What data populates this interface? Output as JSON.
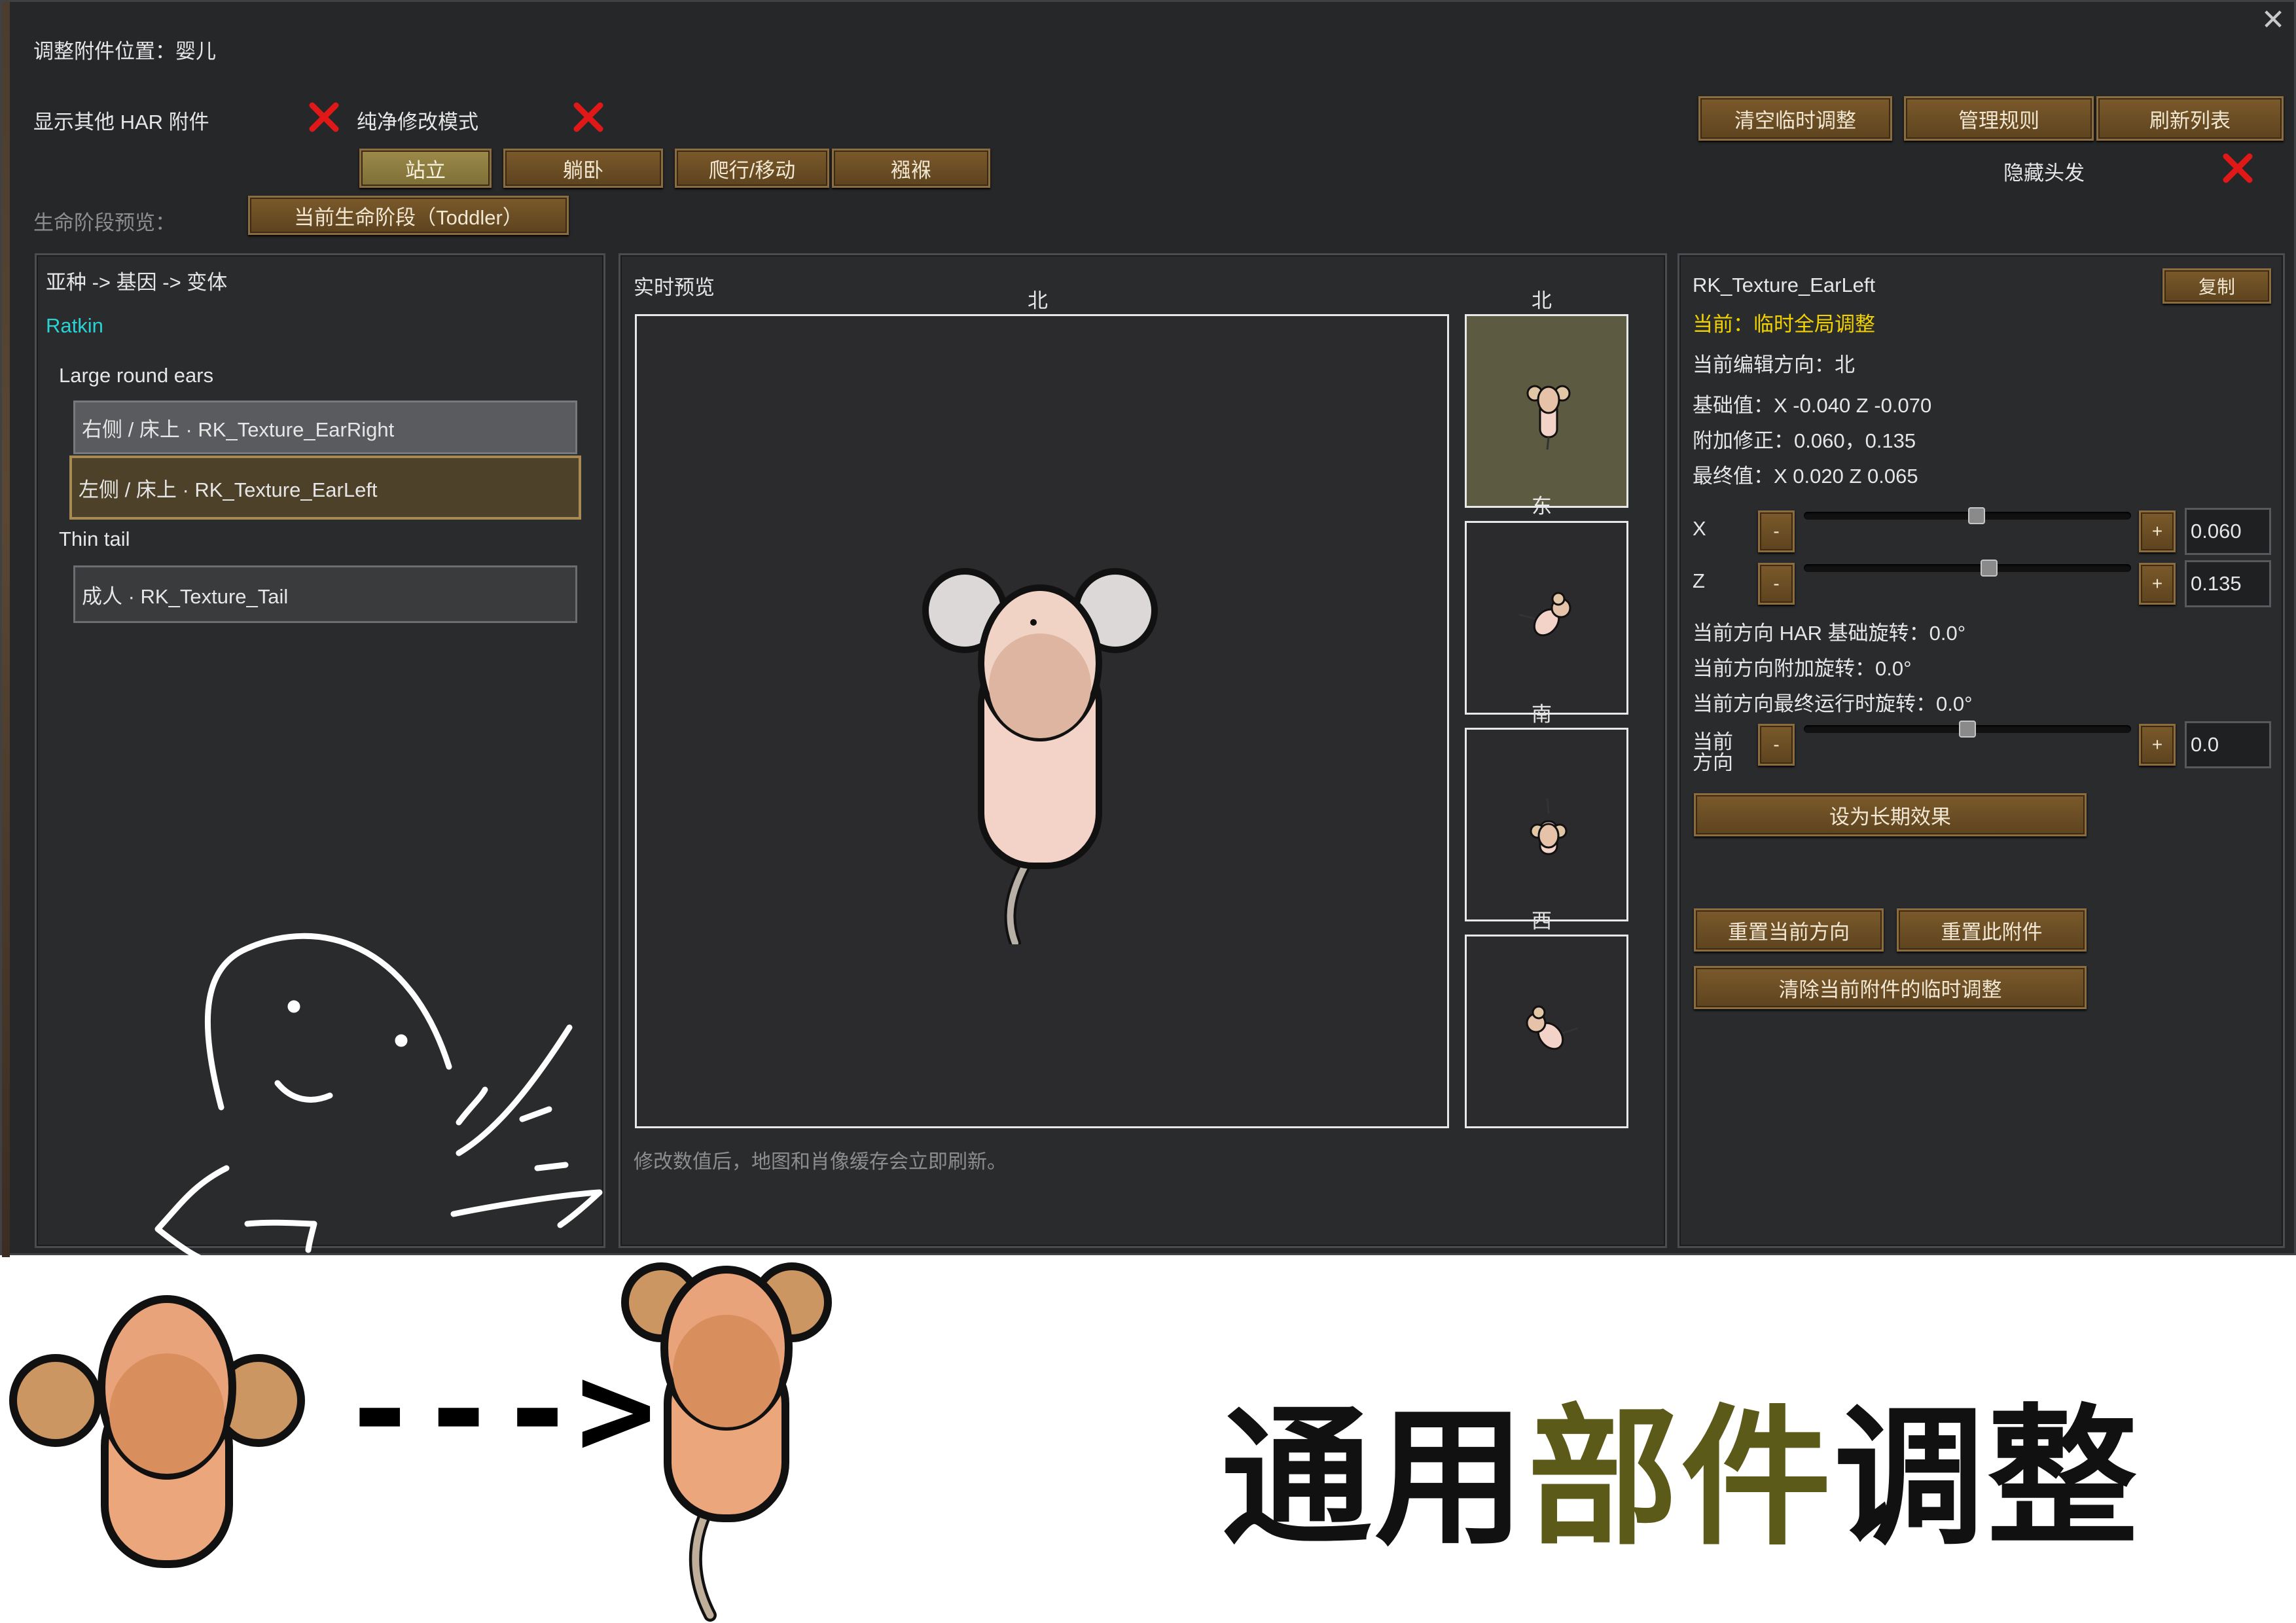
{
  "window": {
    "title": "调整附件位置：婴儿"
  },
  "toolbar": {
    "show_other_har": "显示其他 HAR 附件",
    "pure_edit_mode": "纯净修改模式",
    "clear_temp": "清空临时调整",
    "manage_rules": "管理规则",
    "refresh_list": "刷新列表",
    "hide_hair": "隐藏头发",
    "poses": [
      "站立",
      "躺卧",
      "爬行/移动",
      "襁褓"
    ],
    "life_stage_label": "生命阶段预览：",
    "life_stage_button": "当前生命阶段（Toddler）"
  },
  "left_panel": {
    "header": "亚种 -> 基因 -> 变体",
    "species": "Ratkin",
    "groups": [
      {
        "label": "Large round ears",
        "items": [
          "右侧 / 床上 · RK_Texture_EarRight",
          "左侧 / 床上 · RK_Texture_EarLeft"
        ]
      },
      {
        "label": "Thin tail",
        "items": [
          "成人 · RK_Texture_Tail"
        ]
      }
    ]
  },
  "preview_panel": {
    "title": "实时预览",
    "main_direction": "北",
    "thumb_directions": [
      "北",
      "东",
      "南",
      "西"
    ],
    "note": "修改数值后，地图和肖像缓存会立即刷新。"
  },
  "right_panel": {
    "texture_name": "RK_Texture_EarLeft",
    "copy_button": "复制",
    "current_mode": "当前：临时全局调整",
    "edit_direction": "当前编辑方向：北",
    "base_value": "基础值：X -0.040 Z -0.070",
    "extra_offset": "附加修正：0.060，0.135",
    "final_value": "最终值：X 0.020 Z 0.065",
    "x_label": "X",
    "z_label": "Z",
    "x_value": "0.060",
    "z_value": "0.135",
    "x_slider_level": 0.53,
    "z_slider_level": 0.57,
    "rot_slider_level": 0.5,
    "minus": "-",
    "plus": "+",
    "har_base_rotation": "当前方向 HAR 基础旋转：0.0°",
    "extra_rotation": "当前方向附加旋转：0.0°",
    "final_rotation": "当前方向最终运行时旋转：0.0°",
    "rotation_label": "当前方向",
    "rotation_value": "0.0",
    "set_long_term": "设为长期效果",
    "reset_direction": "重置当前方向",
    "reset_attachment": "重置此附件",
    "clear_attachment_temp": "清除当前附件的临时调整"
  },
  "footer": {
    "arrow": "--->",
    "title_part1": "通用",
    "title_part2": "部件",
    "title_part3": "调整"
  },
  "colors": {
    "accent_yellow": "#f2d200",
    "species_cyan": "#29d3d3",
    "button_brown": "#6b4e25",
    "footer_accent": "#5b5a18",
    "disabled_red_x": "#e01818"
  }
}
